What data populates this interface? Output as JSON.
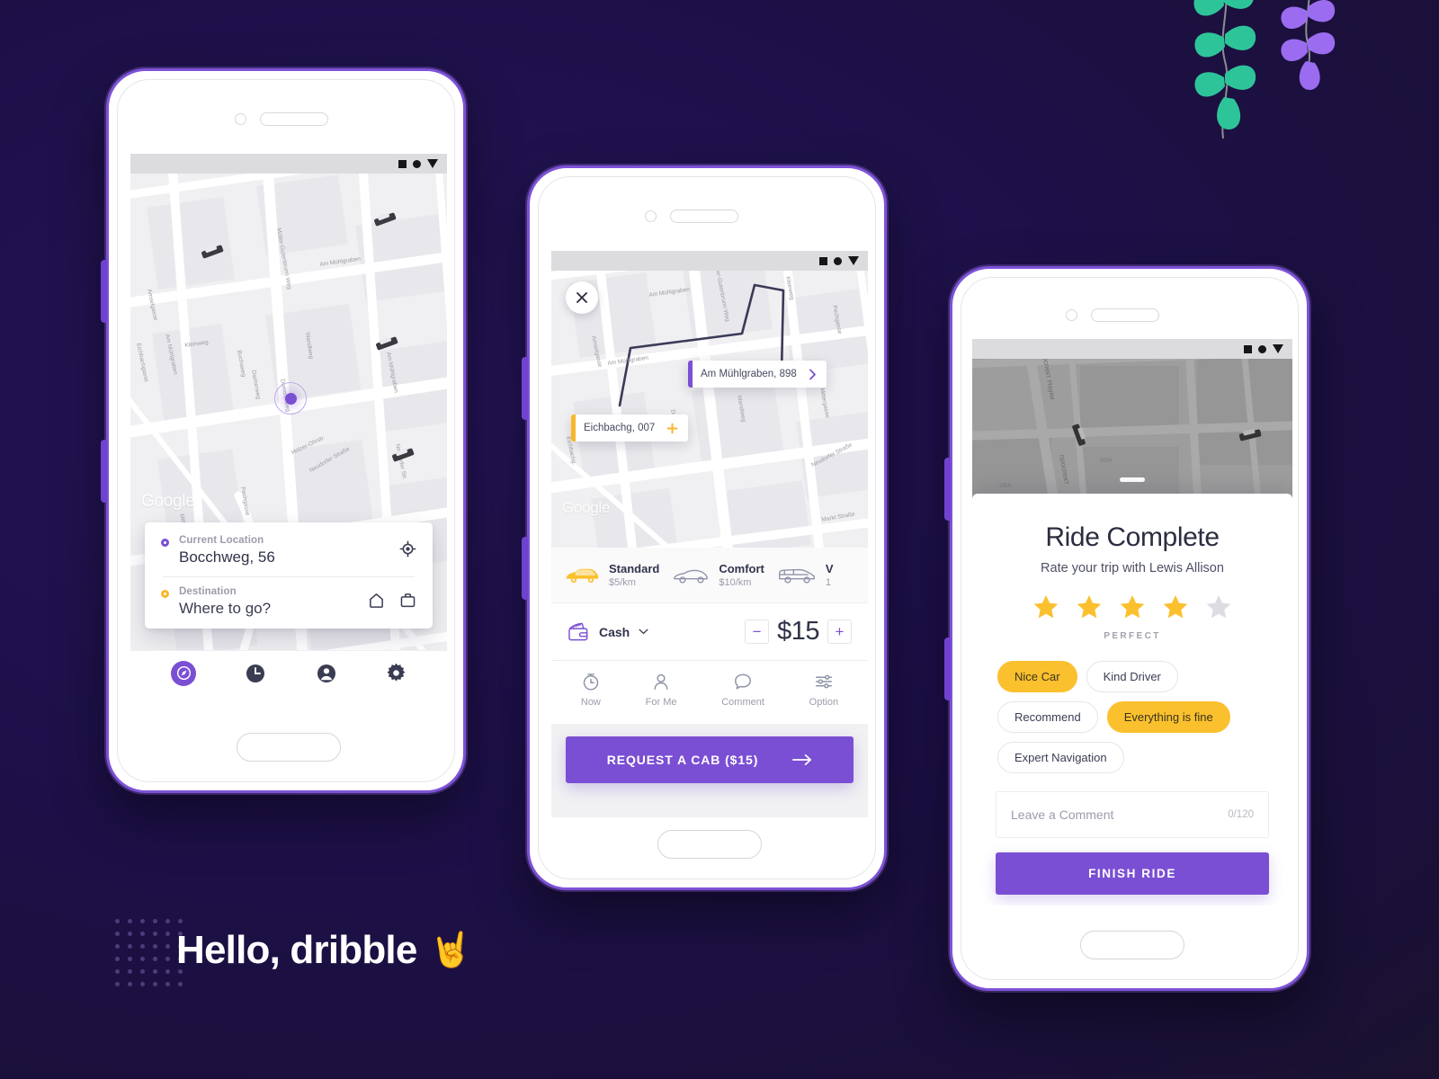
{
  "theme": {
    "bg_start": "#241456",
    "bg_end": "#191426",
    "purple": "#7b4fd4",
    "amber": "#f9b62b",
    "yellow": "#fbc02d",
    "teal": "#2ec49a",
    "violet_leaf": "#9b6cf0",
    "dark_text": "#2f3247",
    "muted_text": "#9c9cab"
  },
  "branding": {
    "hello_text": "Hello, dribble",
    "hello_emoji": "🤘",
    "dotgrid_name": "dot-grid-decoration",
    "vine_left_color": "#2ec49a",
    "vine_right_color": "#9b6cf0"
  },
  "status_bar": {
    "icons": [
      "square-icon",
      "circle-icon",
      "triangle-down-icon"
    ]
  },
  "phone1": {
    "name": "home-map-screen",
    "map": {
      "watermark": "Google",
      "labels": [
        "Am Mühlgraben",
        "Müller-Gutenbrunn Weg",
        "Am Mühlgraben",
        "Amselgasse",
        "Kleinweg",
        "Wandlweg",
        "Buchsweg",
        "Daimerweg",
        "Eichbachgasse",
        "Am Mühlgraben",
        "Neudorfer Straße",
        "Neudorfer Str.",
        "Mittergasse",
        "Eichbachg.",
        "Pechgasse",
        "Holzer-Ohrstr.",
        "Dommerweg",
        "Kunstgasse"
      ],
      "user_marker": "current-location-dot",
      "cars": 4
    },
    "location_card": {
      "current_label": "Current Location",
      "current_value": "Bocchweg, 56",
      "destination_label": "Destination",
      "destination_value": "Where to go?",
      "locate_icon": "crosshair-icon",
      "home_icon": "home-icon",
      "work_icon": "briefcase-icon"
    },
    "tabs": [
      {
        "name": "tab-explore",
        "icon": "compass-icon",
        "active": true
      },
      {
        "name": "tab-history",
        "icon": "clock-icon",
        "active": false
      },
      {
        "name": "tab-profile",
        "icon": "person-icon",
        "active": false
      },
      {
        "name": "tab-settings",
        "icon": "gear-icon",
        "active": false
      }
    ]
  },
  "phone2": {
    "name": "request-cab-screen",
    "close_icon": "close-icon",
    "map": {
      "watermark": "Google",
      "labels": [
        "Am Mühlgraben",
        "Amselgasse",
        "Kleinweg",
        "Müller-Gutenbrunn Weg",
        "Am Mühlgraben",
        "Wandlweg",
        "Daimerweg",
        "Eichbachg.",
        "Neudorfer Straße",
        "Mittergasse",
        "Markt Straße",
        "Pechgasse"
      ],
      "destination_pin": {
        "text": "Am Mühlgraben, 898",
        "action_icon": "chevron-right-icon"
      },
      "origin_pin": {
        "text": "Eichbachg, 007",
        "action_icon": "plus-icon"
      }
    },
    "car_options": [
      {
        "name": "Standard",
        "price": "$5/km",
        "icon": "hatchback-icon",
        "selected": true
      },
      {
        "name": "Comfort",
        "price": "$10/km",
        "icon": "sedan-icon",
        "selected": false
      },
      {
        "name": "V",
        "price": "1",
        "icon": "van-icon",
        "selected": false
      }
    ],
    "payment": {
      "icon": "wallet-icon",
      "method": "Cash",
      "chevron": "chevron-down-icon",
      "decrement": "−",
      "increment": "+",
      "fare": "$15"
    },
    "actions": [
      {
        "label": "Now",
        "icon": "stopwatch-icon"
      },
      {
        "label": "For Me",
        "icon": "person-icon"
      },
      {
        "label": "Comment",
        "icon": "chat-bubble-icon"
      },
      {
        "label": "Option",
        "icon": "sliders-icon"
      }
    ],
    "cta": {
      "label": "REQUEST A CAB ($15)",
      "icon": "arrow-right-icon"
    }
  },
  "phone3": {
    "name": "ride-complete-screen",
    "map": {
      "labels": [
        "проспект Науки",
        "проспект",
        "60A",
        "26A"
      ],
      "drag_handle": "sheet-drag-handle",
      "cars": 2
    },
    "title": "Ride Complete",
    "subtitle": "Rate your trip with Lewis Allison",
    "rating": {
      "value": 4,
      "max": 5,
      "caption": "PERFECT"
    },
    "chips": [
      {
        "label": "Nice Car",
        "selected": true
      },
      {
        "label": "Kind Driver",
        "selected": false
      },
      {
        "label": "Recommend",
        "selected": false
      },
      {
        "label": "Everything is fine",
        "selected": true
      },
      {
        "label": "Expert Navigation",
        "selected": false
      }
    ],
    "comment": {
      "placeholder": "Leave a Comment",
      "counter": "0/120"
    },
    "finish_button": "FINISH RIDE"
  }
}
